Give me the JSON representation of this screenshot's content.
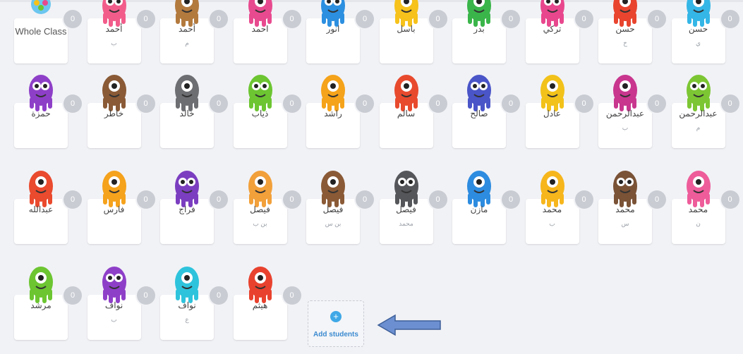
{
  "colors": {
    "background": "#f1f2f6",
    "badge": "#c9ccd3",
    "accent": "#3fa8e6",
    "arrow": "#6b8fd0"
  },
  "whole_class": {
    "label": "Whole Class",
    "points": "0",
    "icon": "class-avatar-icon"
  },
  "students": [
    {
      "name": "أحمد",
      "sub": "ب",
      "points": "0",
      "color": "#f25c8b"
    },
    {
      "name": "أحمد",
      "sub": "م",
      "points": "0",
      "color": "#b37a3e"
    },
    {
      "name": "احمد",
      "sub": "",
      "points": "0",
      "color": "#e84a8f"
    },
    {
      "name": "انور",
      "sub": "",
      "points": "0",
      "color": "#2c8fe0"
    },
    {
      "name": "باسل",
      "sub": "",
      "points": "0",
      "color": "#f6c21b"
    },
    {
      "name": "بدر",
      "sub": "",
      "points": "0",
      "color": "#3ab54a"
    },
    {
      "name": "تركي",
      "sub": "",
      "points": "0",
      "color": "#e8478d"
    },
    {
      "name": "حسن",
      "sub": "خ",
      "points": "0",
      "color": "#e8442e"
    },
    {
      "name": "حسن",
      "sub": "ي",
      "points": "0",
      "color": "#34b6e6"
    },
    {
      "name": "حمزة",
      "sub": "",
      "points": "0",
      "color": "#8e3fc8"
    },
    {
      "name": "خاطر",
      "sub": "",
      "points": "0",
      "color": "#8a5a36"
    },
    {
      "name": "خالد",
      "sub": "",
      "points": "0",
      "color": "#6d6e72"
    },
    {
      "name": "ذياب",
      "sub": "",
      "points": "0",
      "color": "#6cc531"
    },
    {
      "name": "راشد",
      "sub": "",
      "points": "0",
      "color": "#f5a31a"
    },
    {
      "name": "سالم",
      "sub": "",
      "points": "0",
      "color": "#e84a2e"
    },
    {
      "name": "صالح",
      "sub": "",
      "points": "0",
      "color": "#4a55c8"
    },
    {
      "name": "عادل",
      "sub": "",
      "points": "0",
      "color": "#f2c21a"
    },
    {
      "name": "عبدالرحمن",
      "sub": "ب",
      "points": "0",
      "color": "#c8368e"
    },
    {
      "name": "عبدالرحمن",
      "sub": "م",
      "points": "0",
      "color": "#7cc633"
    },
    {
      "name": "عبدالله",
      "sub": "",
      "points": "0",
      "color": "#ea4a2e"
    },
    {
      "name": "فارس",
      "sub": "",
      "points": "0",
      "color": "#f5a21c"
    },
    {
      "name": "فراج",
      "sub": "",
      "points": "0",
      "color": "#7b3ec0"
    },
    {
      "name": "فيصل",
      "sub": "بن ب",
      "points": "0",
      "color": "#f2a03a"
    },
    {
      "name": "فيصل",
      "sub": "بن س",
      "points": "0",
      "color": "#8a5a36"
    },
    {
      "name": "فيصل",
      "sub": "محمد",
      "points": "0",
      "color": "#55565a"
    },
    {
      "name": "مازن",
      "sub": "",
      "points": "0",
      "color": "#2d8ce0"
    },
    {
      "name": "محمد",
      "sub": "ب",
      "points": "0",
      "color": "#f6b61c"
    },
    {
      "name": "محمد",
      "sub": "س",
      "points": "0",
      "color": "#7a5236"
    },
    {
      "name": "محمد",
      "sub": "ن",
      "points": "0",
      "color": "#ee5c9a"
    },
    {
      "name": "مرشد",
      "sub": "",
      "points": "0",
      "color": "#6cc531"
    },
    {
      "name": "نواف",
      "sub": "ب",
      "points": "0",
      "color": "#8e3fc8"
    },
    {
      "name": "نواف",
      "sub": "ع",
      "points": "0",
      "color": "#2ec3dc"
    },
    {
      "name": "هيثم",
      "sub": "",
      "points": "0",
      "color": "#e8422e"
    }
  ],
  "add_students": {
    "label": "Add students",
    "icon": "plus-icon"
  },
  "pointer": {
    "icon": "left-arrow-icon"
  }
}
